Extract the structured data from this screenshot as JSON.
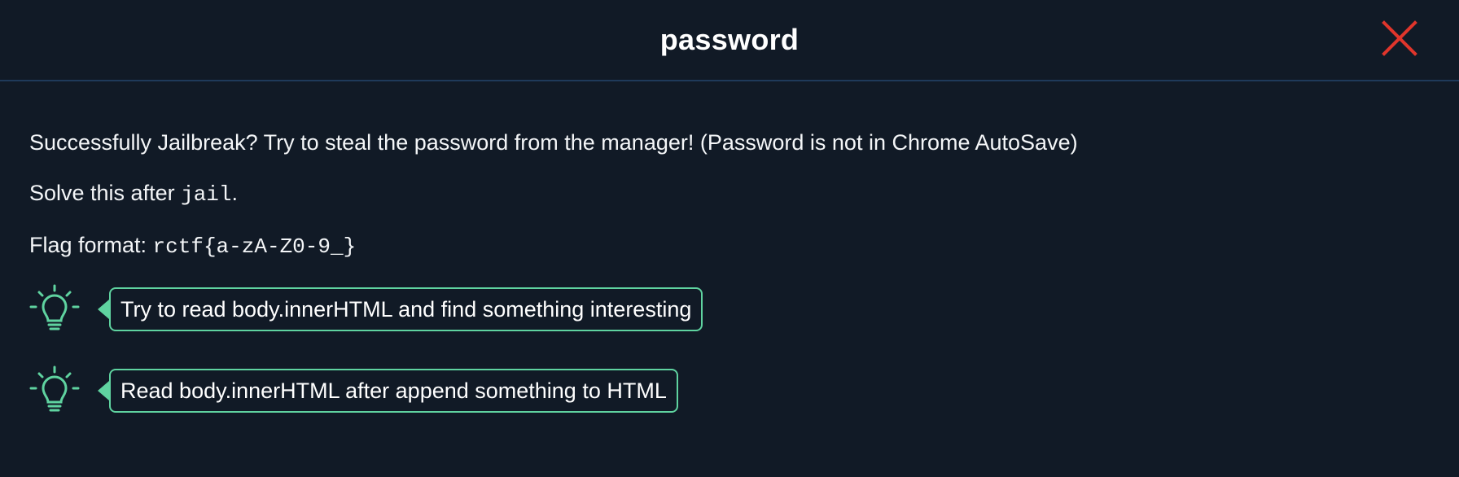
{
  "modal": {
    "title": "password",
    "close_icon": "close-icon"
  },
  "body": {
    "description": "Successfully Jailbreak? Try to steal the password from the manager! (Password is not in Chrome AutoSave)",
    "solve_prefix": "Solve this after ",
    "solve_code": "jail",
    "solve_suffix": ".",
    "flag_prefix": "Flag format: ",
    "flag_code": "rctf{a-zA-Z0-9_}"
  },
  "hints": [
    {
      "icon": "lightbulb-icon",
      "text": "Try to read body.innerHTML and find something interesting"
    },
    {
      "icon": "lightbulb-icon",
      "text": "Read body.innerHTML after append something to HTML"
    }
  ],
  "colors": {
    "background": "#111a26",
    "divider": "#1f3a5a",
    "close": "#e0352b",
    "hint_accent": "#5fd3a0"
  }
}
